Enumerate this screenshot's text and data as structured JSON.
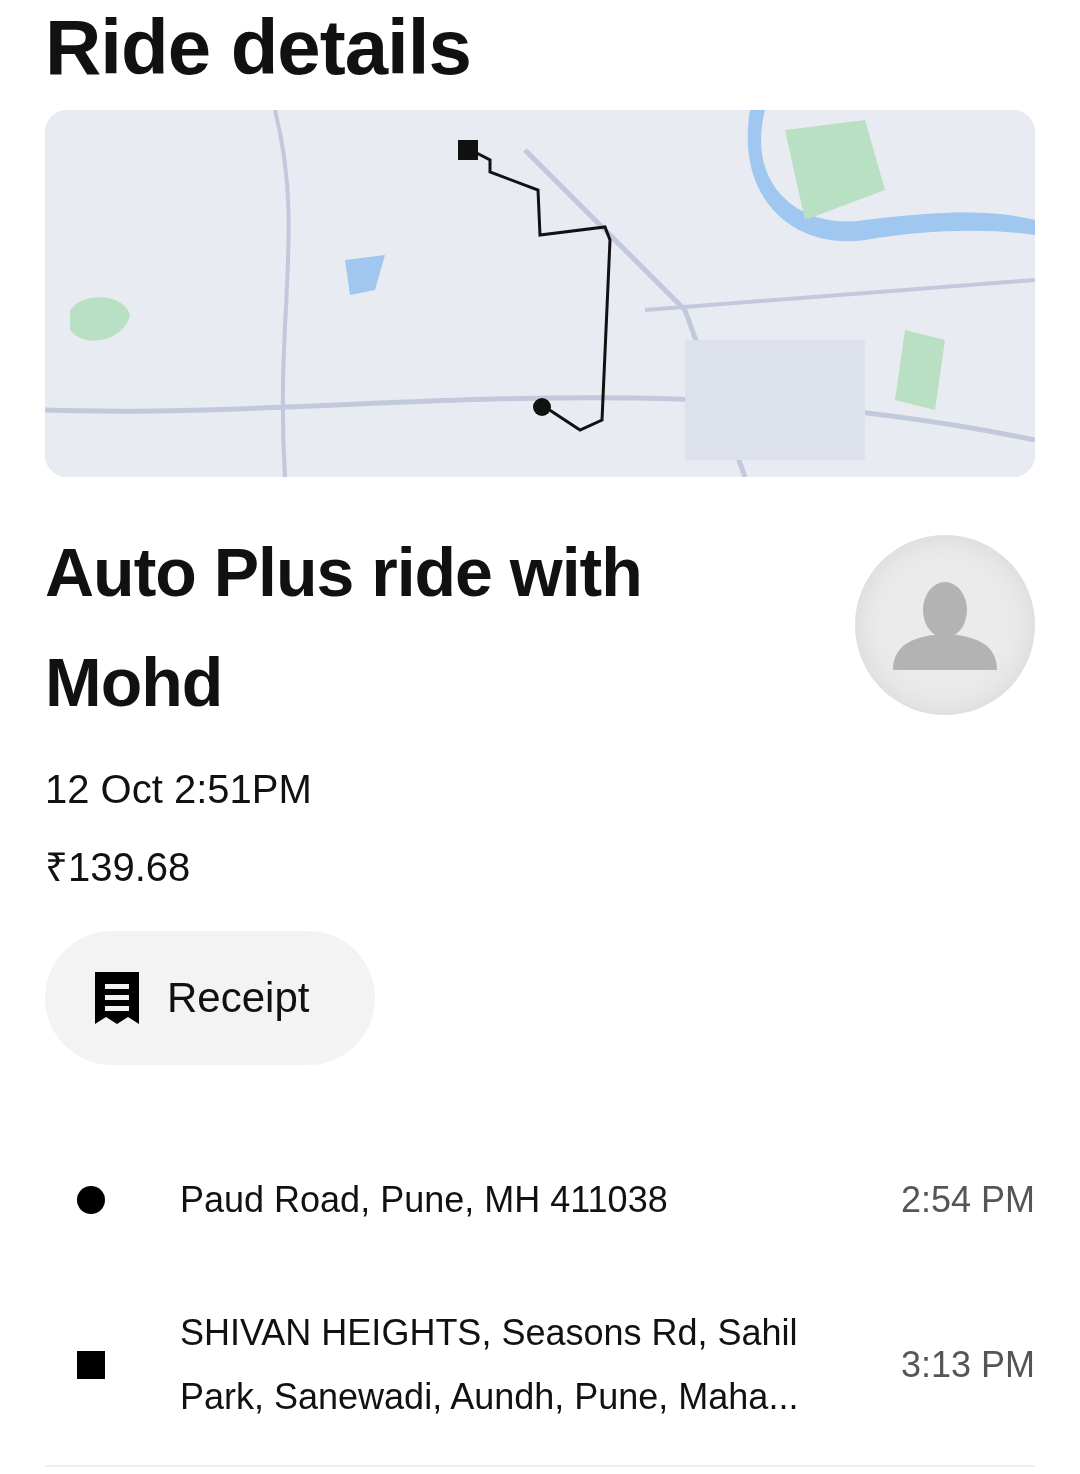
{
  "title": "Ride details",
  "ride": {
    "heading": "Auto Plus ride with Mohd",
    "date": "12 Oct 2:51PM",
    "price": "₹139.68"
  },
  "receipt_button": {
    "label": "Receipt"
  },
  "stops": [
    {
      "kind": "pickup",
      "address": "Paud Road, Pune, MH 411038",
      "time": "2:54 PM"
    },
    {
      "kind": "dropoff",
      "address": "SHIVAN HEIGHTS, Seasons Rd, Sahil Park, Sanewadi, Aundh, Pune, Maha...",
      "time": "3:13 PM"
    }
  ]
}
